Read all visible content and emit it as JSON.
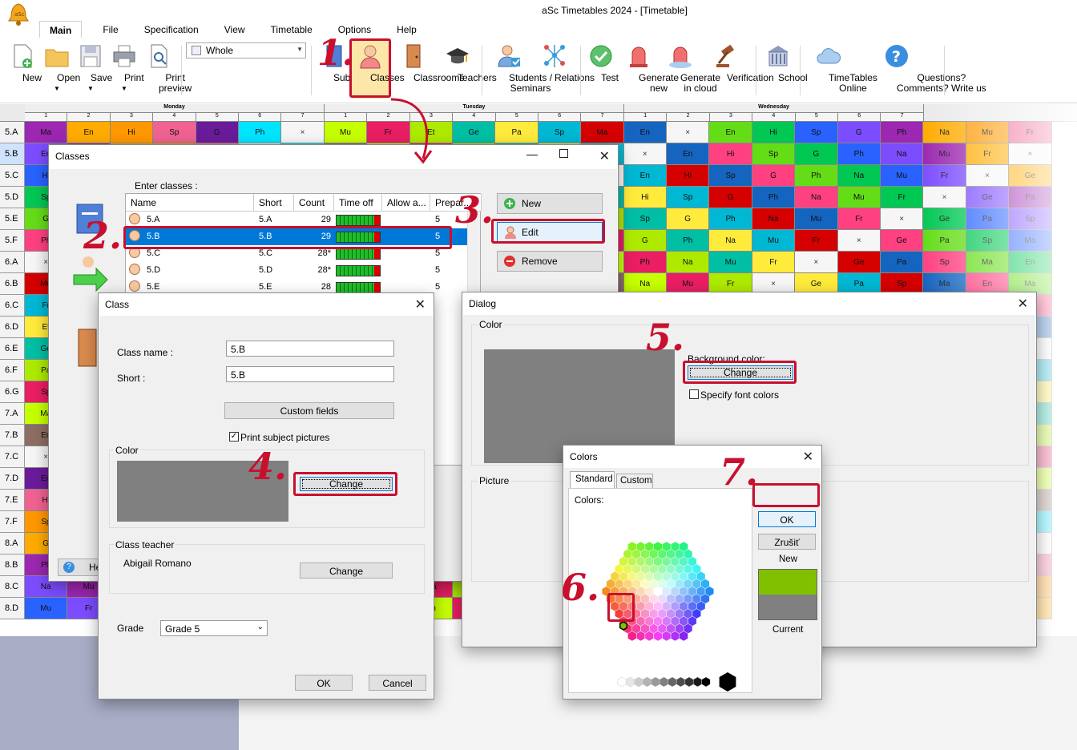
{
  "app": {
    "title": "aSc Timetables 2024  - [Timetable]"
  },
  "menu": [
    "Main",
    "File",
    "Specification",
    "View",
    "Timetable",
    "Options",
    "Help"
  ],
  "ribbon": {
    "buttons": [
      {
        "name": "new",
        "label": "New"
      },
      {
        "name": "open",
        "label": "Open"
      },
      {
        "name": "save",
        "label": "Save"
      },
      {
        "name": "print",
        "label": "Print"
      },
      {
        "name": "print-preview",
        "label": "Print\npreview"
      },
      {
        "name": "subjects",
        "label": "Subjects"
      },
      {
        "name": "classes",
        "label": "Classes"
      },
      {
        "name": "classrooms",
        "label": "Classrooms"
      },
      {
        "name": "teachers",
        "label": "Teachers"
      },
      {
        "name": "students-seminars",
        "label": "Students /\nSeminars"
      },
      {
        "name": "relations",
        "label": "Relations"
      },
      {
        "name": "test",
        "label": "Test"
      },
      {
        "name": "generate-new",
        "label": "Generate\nnew"
      },
      {
        "name": "generate-cloud",
        "label": "Generate\nin cloud"
      },
      {
        "name": "verification",
        "label": "Verification"
      },
      {
        "name": "school",
        "label": "School"
      },
      {
        "name": "timetables-online",
        "label": "TimeTables\nOnline"
      },
      {
        "name": "questions",
        "label": "Questions?\nComments? Write us"
      }
    ],
    "view_select": "Whole"
  },
  "steps": [
    "1.",
    "2.",
    "3.",
    "4.",
    "5.",
    "6.",
    "7."
  ],
  "grid": {
    "days": [
      "Monday",
      "Tuesday",
      "Wednesday"
    ],
    "periods": [
      "1",
      "2",
      "3",
      "4",
      "5",
      "6",
      "7"
    ],
    "rows": [
      "5.A",
      "5.B",
      "5.C",
      "5.D",
      "5.E",
      "5.F",
      "6.A",
      "6.B",
      "6.C",
      "6.D",
      "6.E",
      "6.F",
      "6.G",
      "7.A",
      "7.B",
      "7.C",
      "7.D",
      "7.E",
      "7.F",
      "8.A",
      "8.B",
      "8.C",
      "8.D"
    ]
  },
  "classes_dialog": {
    "title": "Classes",
    "enter_label": "Enter classes :",
    "columns": [
      "Name",
      "Short",
      "Count",
      "Time off",
      "Allow a...",
      "Prepar..."
    ],
    "rows": [
      {
        "name": "5.A",
        "short": "5.A",
        "count": "29",
        "prep": "5"
      },
      {
        "name": "5.B",
        "short": "5.B",
        "count": "29",
        "prep": "5"
      },
      {
        "name": "5.C",
        "short": "5.C",
        "count": "28*",
        "prep": "5"
      },
      {
        "name": "5.D",
        "short": "5.D",
        "count": "28*",
        "prep": "5"
      },
      {
        "name": "5.E",
        "short": "5.E",
        "count": "28",
        "prep": "5"
      }
    ],
    "new_btn": "New",
    "edit_btn": "Edit",
    "remove_btn": "Remove",
    "help_btn": "He"
  },
  "class_dialog": {
    "title": "Class",
    "name_label": "Class name :",
    "name_value": "5.B",
    "short_label": "Short :",
    "short_value": "5.B",
    "custom_fields": "Custom fields",
    "print_pictures": "Print subject pictures",
    "color_group": "Color",
    "change_color": "Change",
    "teacher_group": "Class teacher",
    "teacher_name": "Abigail Romano",
    "change_teacher": "Change",
    "grade_label": "Grade",
    "grade_value": "Grade 5",
    "ok": "OK",
    "cancel": "Cancel"
  },
  "dialog": {
    "title": "Dialog",
    "color_group": "Color",
    "bg_label": "Background color:",
    "change": "Change",
    "font_colors": "Specify font colors",
    "picture_group": "Picture"
  },
  "colors_dialog": {
    "title": "Colors",
    "tab_standard": "Standard",
    "tab_custom": "Custom",
    "colors_label": "Colors:",
    "ok": "OK",
    "cancel": "Zrušiť",
    "new_label": "New",
    "current_label": "Current",
    "new_color": "#80c000",
    "current_color": "#808080"
  },
  "colors": {
    "accent": "#c8102e",
    "selection": "#0078d7",
    "preview_gray": "#808080"
  }
}
